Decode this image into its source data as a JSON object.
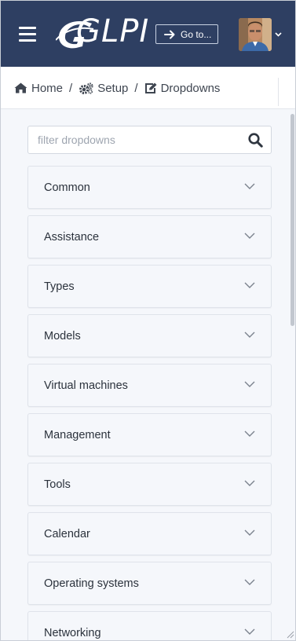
{
  "header": {
    "logo_text": "GLPI",
    "goto_label": "Go to...",
    "colors": {
      "topbar": "#2e3f62",
      "text": "#ffffff"
    }
  },
  "breadcrumb": {
    "items": [
      {
        "label": "Home",
        "icon": "home-icon"
      },
      {
        "label": "Setup",
        "icon": "cogs-icon"
      },
      {
        "label": "Dropdowns",
        "icon": "edit-icon"
      }
    ],
    "separator": "/"
  },
  "filter": {
    "placeholder": "filter dropdowns",
    "value": ""
  },
  "dropdowns": [
    {
      "label": "Common"
    },
    {
      "label": "Assistance"
    },
    {
      "label": "Types"
    },
    {
      "label": "Models"
    },
    {
      "label": "Virtual machines"
    },
    {
      "label": "Management"
    },
    {
      "label": "Tools"
    },
    {
      "label": "Calendar"
    },
    {
      "label": "Operating systems"
    },
    {
      "label": "Networking"
    }
  ]
}
